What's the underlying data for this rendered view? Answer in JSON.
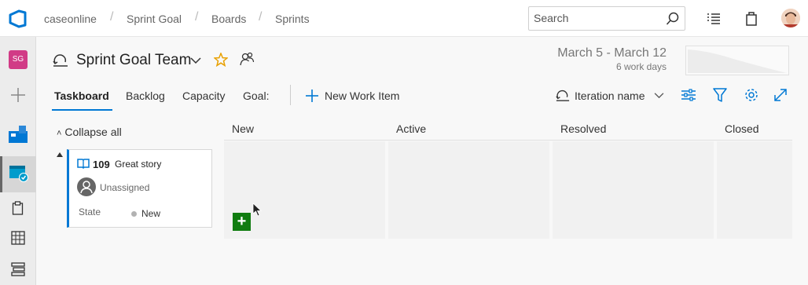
{
  "breadcrumb": [
    "caseonline",
    "Sprint Goal",
    "Boards",
    "Sprints"
  ],
  "search": {
    "placeholder": "Search"
  },
  "team": {
    "initials": "SG",
    "name": "Sprint Goal Team"
  },
  "sprint": {
    "dates": "March 5 - March 12",
    "work_days": "6 work days"
  },
  "tabs": [
    "Taskboard",
    "Backlog",
    "Capacity",
    "Goal:"
  ],
  "toolbar": {
    "new_item": "New Work Item",
    "iteration": "Iteration name"
  },
  "board": {
    "collapse_label": "Collapse all",
    "columns": [
      "New",
      "Active",
      "Resolved",
      "Closed"
    ]
  },
  "card": {
    "id": "109",
    "title": "Great story",
    "assignee": "Unassigned",
    "state_label": "State",
    "state_value": "New"
  },
  "colors": {
    "accent": "#0078d4",
    "add_button": "#107c10",
    "team_badge": "#d13b86"
  },
  "icons": [
    "azure-devops-logo-icon",
    "search-icon",
    "checklist-icon",
    "shopping-bag-icon",
    "user-avatar-icon",
    "plus-icon",
    "boards-icon",
    "sprints-icon",
    "clipboard-icon",
    "grid-icon",
    "list-icon",
    "iteration-icon",
    "star-icon",
    "team-members-icon",
    "chevron-down-icon",
    "settings-sliders-icon",
    "filter-icon",
    "gear-icon",
    "expand-icon",
    "book-icon",
    "mouse-pointer-icon"
  ]
}
